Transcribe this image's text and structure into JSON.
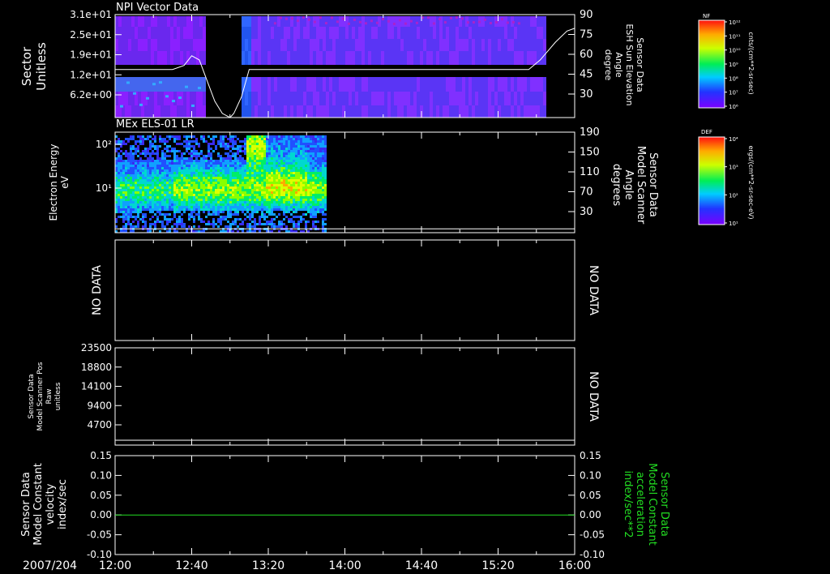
{
  "figure": {
    "date": "2007/204",
    "time_ticks": [
      "12:00",
      "12:40",
      "13:20",
      "14:00",
      "14:40",
      "15:20",
      "16:00"
    ]
  },
  "chart_data": [
    {
      "type": "heatmap",
      "title": "NPI Vector Data",
      "ylabel": "Sector",
      "yunit": "Unitless",
      "ytick_labels": [
        "3.1e+01",
        "2.5e+01",
        "1.9e+01",
        "1.2e+01",
        "6.2e+00"
      ],
      "right_axis": {
        "label_lines": [
          "Sensor Data",
          "ESH Sun Elevation",
          "Angle",
          "degree"
        ],
        "ticks": [
          "90",
          "75",
          "60",
          "45",
          "30"
        ],
        "ylim": [
          15,
          90
        ]
      },
      "line_series": {
        "x": [
          "12:00",
          "12:30",
          "12:36",
          "12:40",
          "12:44",
          "12:48",
          "12:52",
          "12:56",
          "13:00",
          "13:02",
          "13:06",
          "13:10",
          "15:30",
          "15:36",
          "15:42",
          "15:50",
          "15:56",
          "16:00"
        ],
        "y": [
          50,
          50,
          53,
          60,
          57,
          42,
          27,
          18,
          15,
          18,
          30,
          50,
          50,
          50,
          57,
          70,
          78,
          80
        ]
      },
      "colorbar": {
        "label": "NF",
        "unit": "cnts/(cm**2-sr-sec)",
        "ticks": [
          "10¹²",
          "10¹¹",
          "10¹⁰",
          "10⁹",
          "10⁸",
          "10⁷",
          "10⁶"
        ]
      },
      "data_extent": [
        "12:00",
        "15:44"
      ],
      "gap": [
        "12:46",
        "13:06"
      ]
    },
    {
      "type": "heatmap",
      "title": "MEx ELS-01 LR",
      "ylabel": "Electron Energy",
      "yunit": "eV",
      "ytick_labels": [
        "10²",
        "10¹"
      ],
      "right_axis": {
        "label_lines": [
          "Sensor Data",
          "Model Scanner",
          "Angle",
          "degrees"
        ],
        "ticks": [
          "190",
          "150",
          "110",
          "70",
          "30"
        ],
        "ylim": [
          5,
          190
        ]
      },
      "line_series": {
        "x": [
          "12:00",
          "16:00"
        ],
        "y": [
          12,
          12
        ]
      },
      "colorbar": {
        "label": "DEF",
        "unit": "ergs/(cm**2-sr-sec-eV)",
        "ticks": [
          "10⁴",
          "10³",
          "10²",
          "10¹"
        ]
      },
      "data_extent": [
        "12:00",
        "13:50"
      ]
    },
    {
      "type": "line",
      "left_label": "NO DATA",
      "right_label": "NO DATA"
    },
    {
      "type": "line",
      "ylabel_lines": [
        "Sensor Data",
        "Model Scanner Pos",
        "Raw",
        "unitless"
      ],
      "ytick_labels": [
        "23500",
        "18800",
        "14100",
        "9400",
        "4700"
      ],
      "ylim": [
        0,
        23500
      ],
      "right_label": "NO DATA",
      "series": [
        {
          "x": [
            "12:00",
            "16:00"
          ],
          "y": [
            0,
            0
          ]
        }
      ]
    },
    {
      "type": "line",
      "ylabel_lines": [
        "Sensor Data",
        "Model Constant",
        "velocity",
        "index/sec"
      ],
      "ytick_labels": [
        "0.15",
        "0.10",
        "0.05",
        "0.00",
        "-0.05",
        "-0.10"
      ],
      "right_ytick_labels": [
        "0.15",
        "0.10",
        "0.05",
        "0.00",
        "-0.05",
        "-0.10"
      ],
      "right_label_lines": [
        "Sensor Data",
        "Model Constant",
        "acceleration",
        "index/sec**2"
      ],
      "ylim": [
        -0.1,
        0.15
      ],
      "series": [
        {
          "x": [
            "12:00",
            "16:00"
          ],
          "y": [
            0.0,
            0.0
          ],
          "color": "#22dd22"
        }
      ]
    }
  ]
}
